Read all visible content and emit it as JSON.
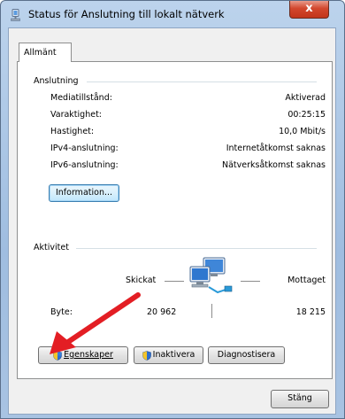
{
  "window": {
    "title": "Status för Anslutning till lokalt nätverk",
    "close_label": "x"
  },
  "tabs": [
    {
      "label": "Allmänt"
    }
  ],
  "connection": {
    "group_title": "Anslutning",
    "rows": [
      {
        "label": "Mediatillstånd:",
        "value": "Aktiverad"
      },
      {
        "label": "Varaktighet:",
        "value": "00:25:15"
      },
      {
        "label": "Hastighet:",
        "value": "10,0 Mbit/s"
      },
      {
        "label": "IPv4-anslutning:",
        "value": "Internetåtkomst saknas"
      },
      {
        "label": "IPv6-anslutning:",
        "value": "Nätverksåtkomst saknas"
      }
    ],
    "details_button": "Information..."
  },
  "activity": {
    "group_title": "Aktivitet",
    "sent_label": "Skickat",
    "received_label": "Mottaget",
    "bytes_label": "Byte:",
    "bytes_sent": "20 962",
    "bytes_received": "18 215"
  },
  "actions": {
    "properties_button": "Egenskaper",
    "disable_button": "Inaktivera",
    "diagnose_button": "Diagnostisera"
  },
  "footer": {
    "close_button": "Stäng"
  },
  "colors": {
    "annotation_arrow": "#e31e24",
    "title_bar": "#bcd3ec"
  }
}
